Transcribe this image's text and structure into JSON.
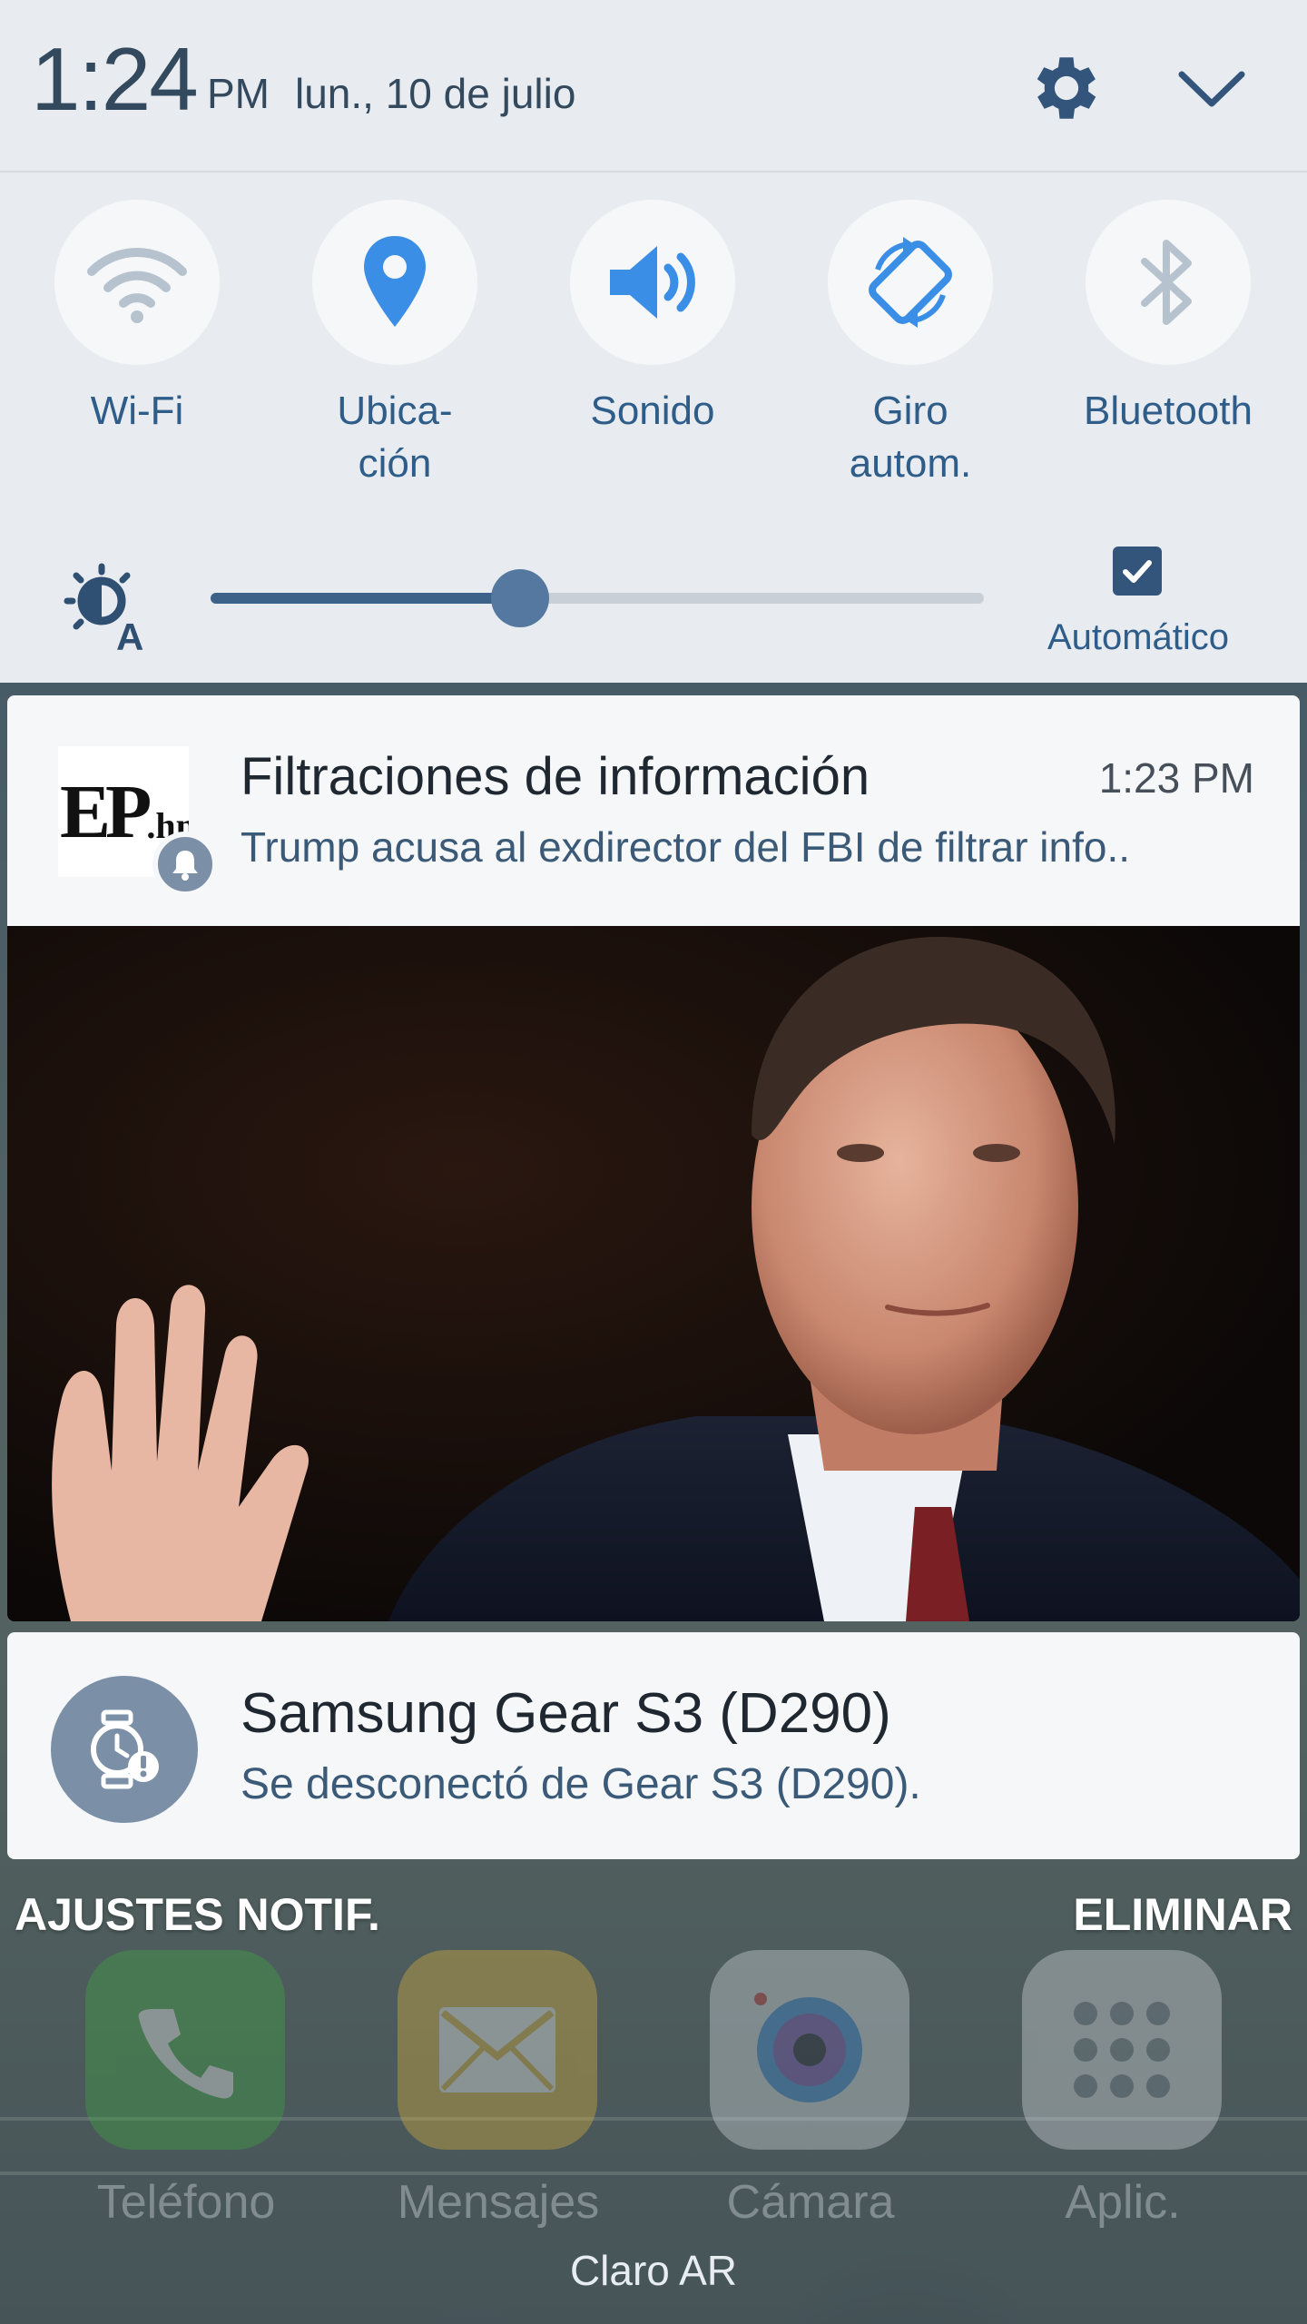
{
  "status": {
    "time": "1:24",
    "ampm": "PM",
    "date": "lun., 10 de julio"
  },
  "quick_toggles": [
    {
      "label": "Wi-Fi",
      "icon": "wifi-icon",
      "state": "off"
    },
    {
      "label": "Ubica-\nción",
      "icon": "location-pin-icon",
      "state": "on"
    },
    {
      "label": "Sonido",
      "icon": "speaker-icon",
      "state": "on"
    },
    {
      "label": "Giro\nautom.",
      "icon": "auto-rotate-icon",
      "state": "on"
    },
    {
      "label": "Bluetooth",
      "icon": "bluetooth-icon",
      "state": "off"
    }
  ],
  "brightness": {
    "level": 0.4,
    "auto_label": "Automático",
    "auto_checked": true
  },
  "notifications": [
    {
      "app_logo_text": "EP.hn",
      "title": "Filtraciones de información",
      "time": "1:23 PM",
      "text": "Trump acusa al exdirector del FBI de filtrar info..",
      "has_image": true
    },
    {
      "title": "Samsung Gear S3 (D290)",
      "text": "Se desconectó de Gear S3 (D290)."
    }
  ],
  "actions": {
    "settings": "AJUSTES NOTIF.",
    "clear": "ELIMINAR"
  },
  "dock": [
    {
      "label": "Teléfono",
      "icon": "phone-icon",
      "color": "#3fae3f"
    },
    {
      "label": "Mensajes",
      "icon": "envelope-icon",
      "color": "#e7b93a"
    },
    {
      "label": "Cámara",
      "icon": "camera-icon",
      "color": "#c9d2db"
    },
    {
      "label": "Aplic.",
      "icon": "apps-grid-icon",
      "color": "#d9dde2"
    }
  ],
  "carrier": "Claro AR",
  "colors": {
    "accent": "#2f5d8a",
    "panel_bg": "#e8ebef",
    "card_bg": "#f6f7f9",
    "badge": "#7b8fa7"
  }
}
